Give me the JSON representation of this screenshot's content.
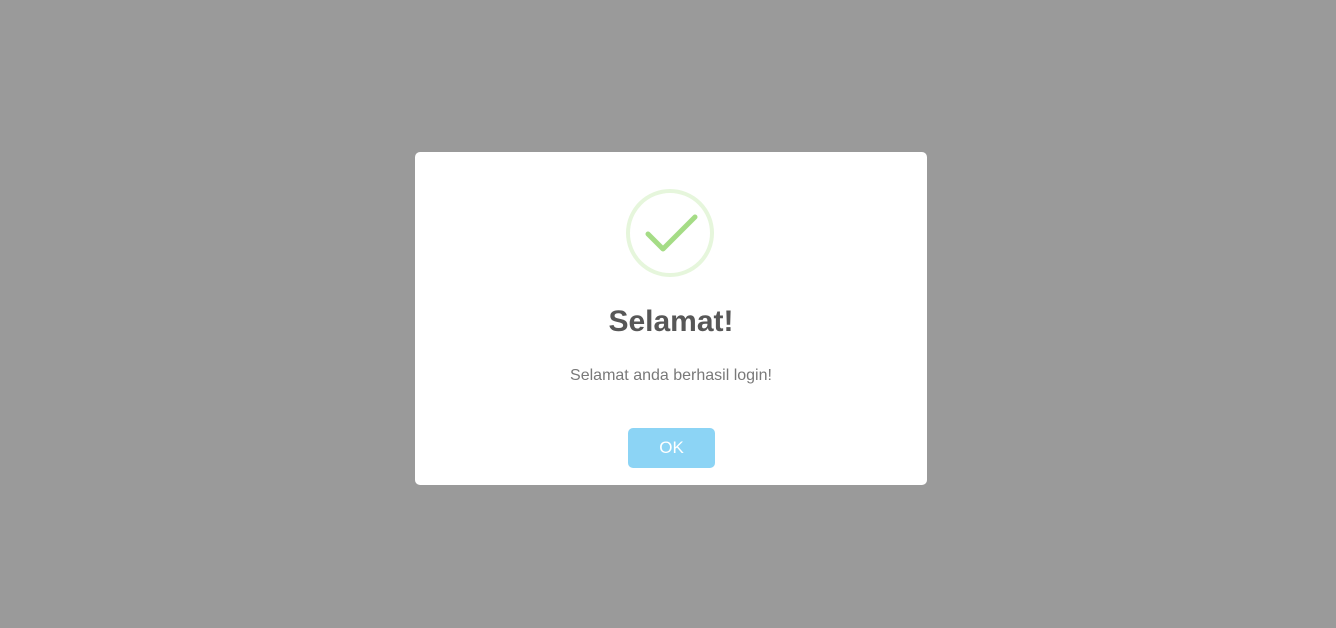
{
  "dialog": {
    "title": "Selamat!",
    "message": "Selamat anda berhasil login!",
    "confirm_label": "OK",
    "icon": "success-check-icon"
  },
  "colors": {
    "overlay": "#9a9a9a",
    "dialog_background": "#ffffff",
    "success_green": "#a5dc86",
    "success_ring": "#e6f6dc",
    "button_background": "#8cd4f5",
    "button_text": "#ffffff",
    "title_text": "#575757",
    "message_text": "#797979"
  }
}
